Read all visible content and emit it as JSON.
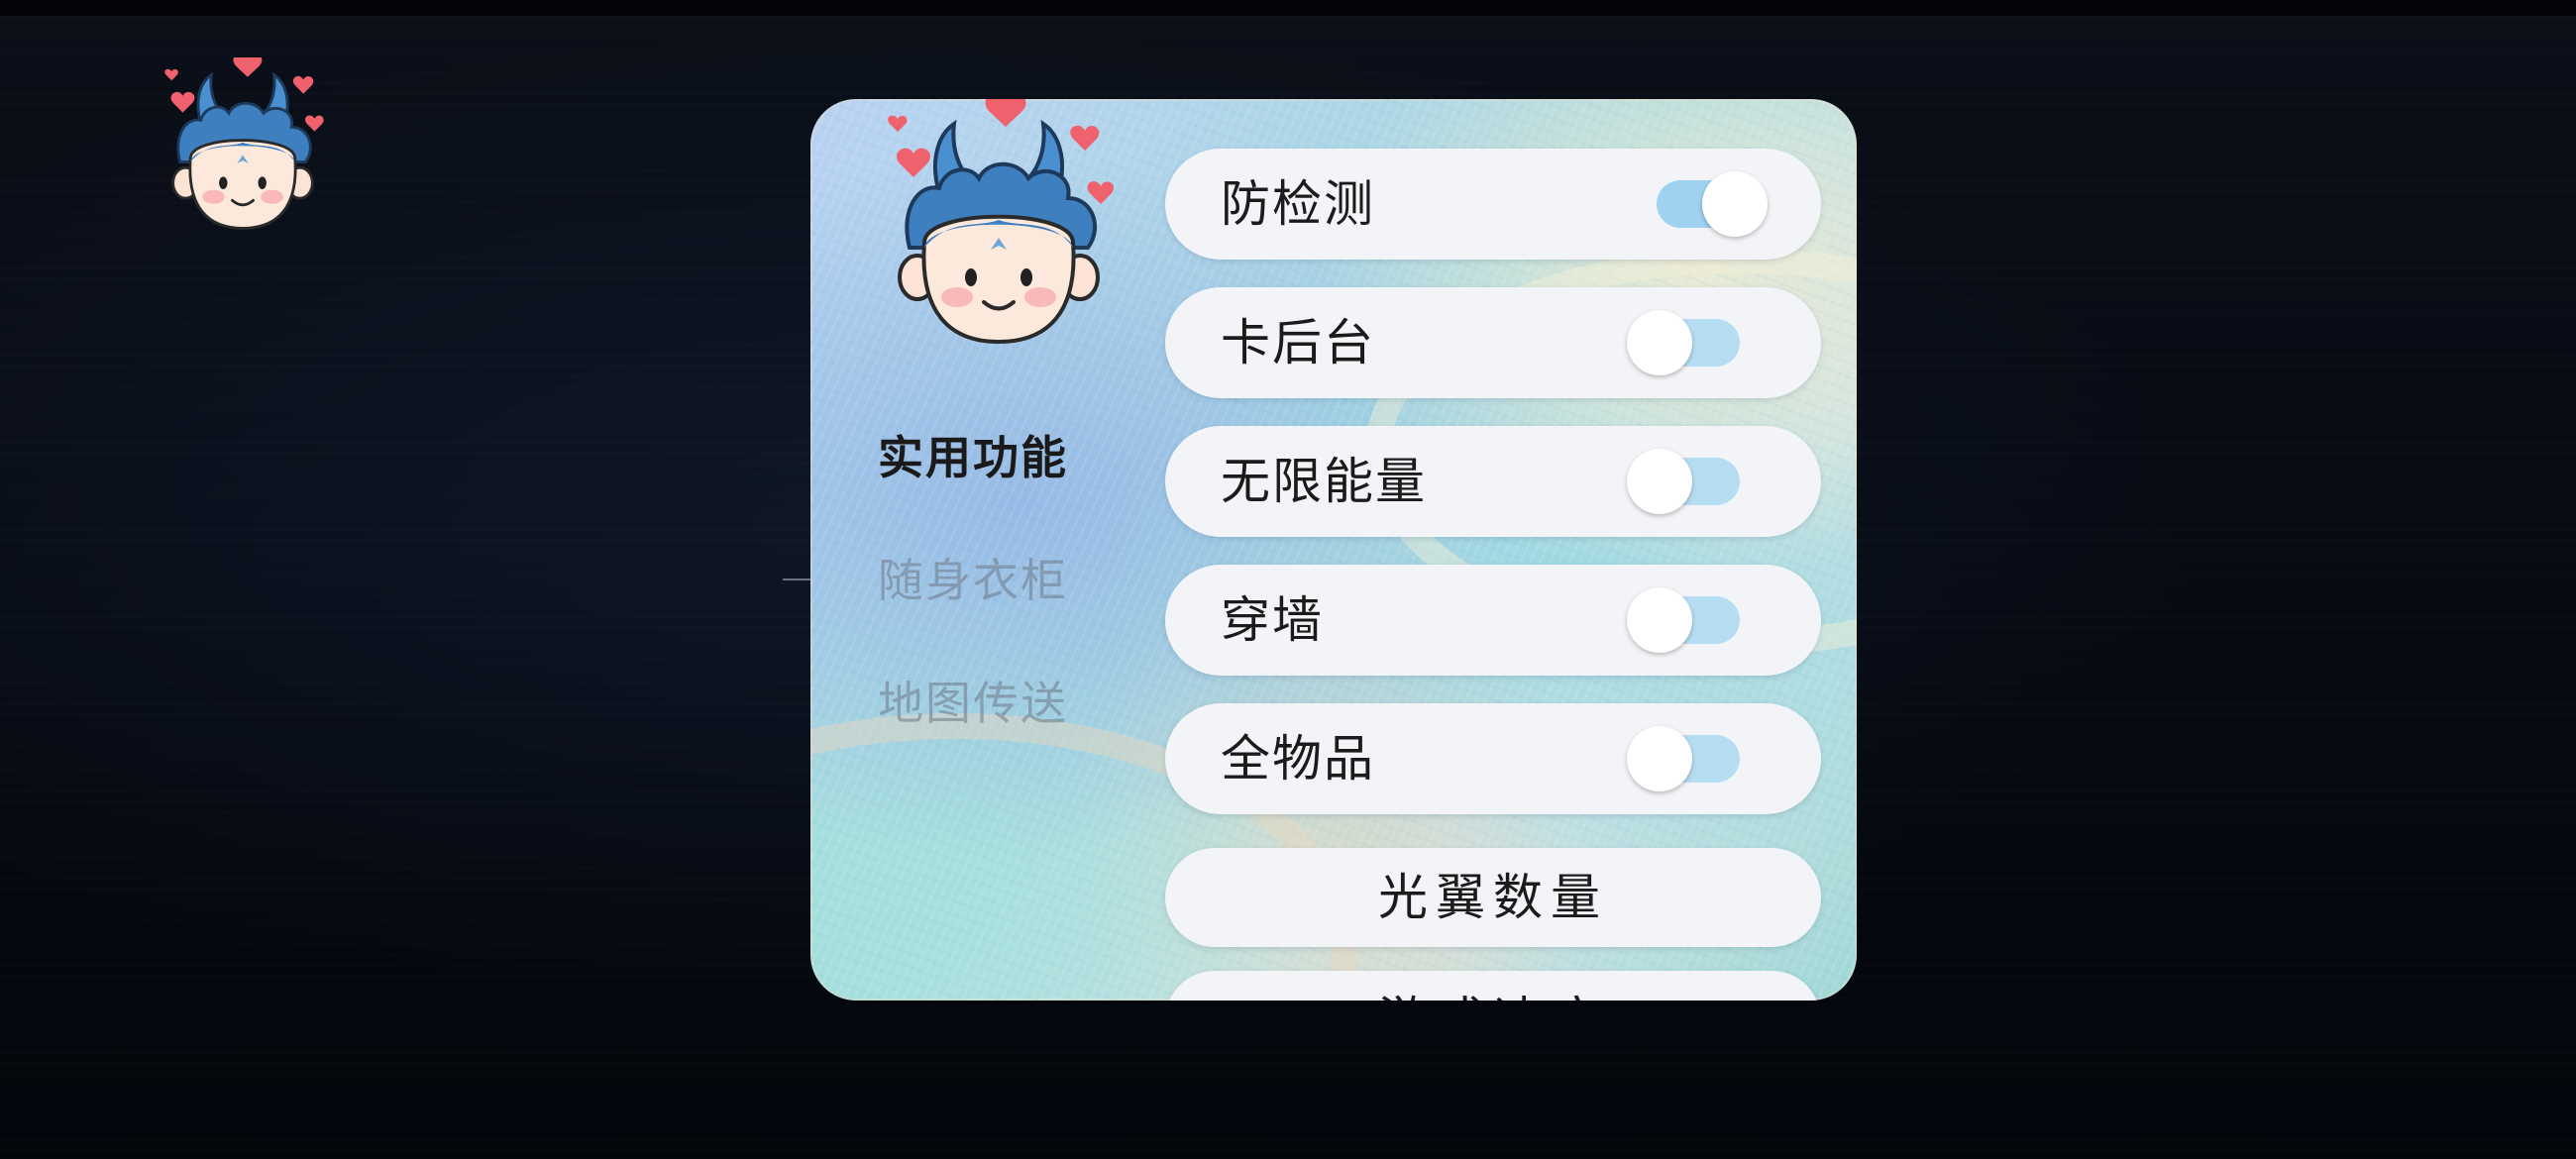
{
  "floating_launcher": {
    "icon": "devil-boy-avatar-icon"
  },
  "panel": {
    "avatar_icon": "devil-boy-avatar-icon",
    "side_menu": [
      {
        "label": "实用功能",
        "active": true
      },
      {
        "label": "随身衣柜",
        "active": false
      },
      {
        "label": "地图传送",
        "active": false
      }
    ],
    "options": [
      {
        "label": "防检测",
        "type": "toggle",
        "enabled": true
      },
      {
        "label": "卡后台",
        "type": "toggle",
        "enabled": false
      },
      {
        "label": "无限能量",
        "type": "toggle",
        "enabled": false
      },
      {
        "label": "穿墙",
        "type": "toggle",
        "enabled": false
      },
      {
        "label": "全物品",
        "type": "toggle",
        "enabled": false
      },
      {
        "label": "光翼数量",
        "type": "button"
      },
      {
        "label": "游戏速度",
        "type": "button"
      }
    ]
  },
  "colors": {
    "toggle_on": "#9ed2f0",
    "toggle_off": "#b6ddf2",
    "card_bg": "#f3f4f7",
    "heart": "#f0616e",
    "hair": "#3e7fbf"
  }
}
